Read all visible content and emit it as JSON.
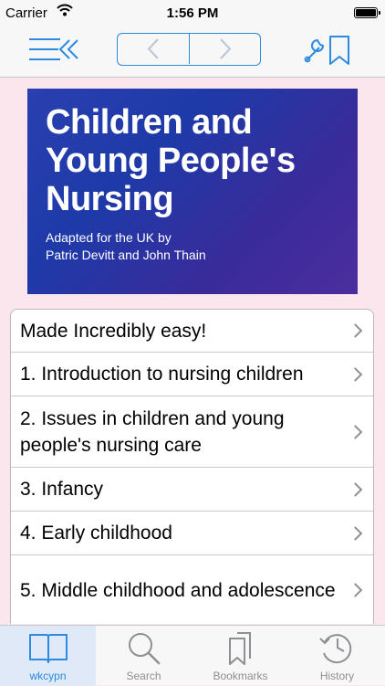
{
  "status_bar": {
    "carrier": "Carrier",
    "time": "1:56 PM"
  },
  "cover": {
    "title_line1": "Children and",
    "title_line2": "Young People's",
    "title_line3": "Nursing",
    "subtitle_line1": "Adapted for the UK by",
    "subtitle_line2": "Patric Devitt and John Thain"
  },
  "toc": {
    "items": [
      {
        "label": "Made Incredibly easy!"
      },
      {
        "label": "1. Introduction to nursing children"
      },
      {
        "label": "2. Issues in children and young people's nursing care"
      },
      {
        "label": "3. Infancy"
      },
      {
        "label": "4. Early childhood"
      },
      {
        "label": "5. Middle childhood and adolescence"
      }
    ]
  },
  "tab_bar": {
    "tabs": [
      {
        "label": "wkcypn",
        "icon": "book-icon",
        "active": true
      },
      {
        "label": "Search",
        "icon": "search-icon",
        "active": false
      },
      {
        "label": "Bookmarks",
        "icon": "bookmarks-icon",
        "active": false
      },
      {
        "label": "History",
        "icon": "history-icon",
        "active": false
      }
    ]
  },
  "colors": {
    "accent": "#2a8be0",
    "background": "#fbe6ee",
    "chevron": "#8e8e93"
  }
}
